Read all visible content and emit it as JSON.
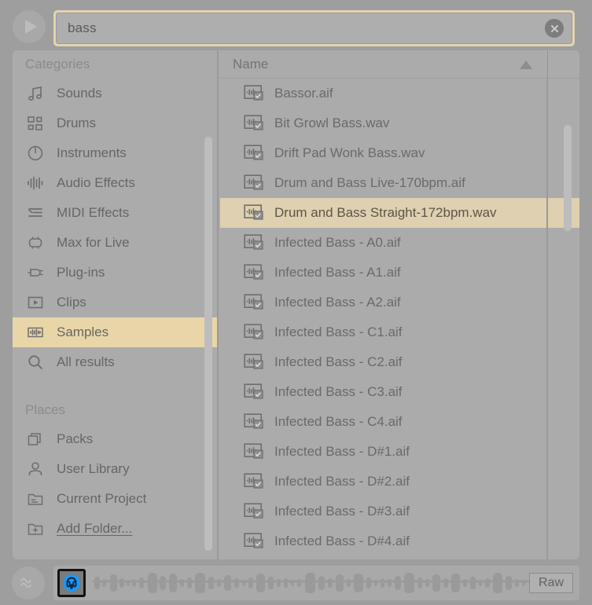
{
  "app": {
    "name": "Ableton Live Browser",
    "accent_highlight": "#e9d6a8",
    "selection_highlight": "#ded0b0",
    "background": "#9e9e9e",
    "panel_background": "#ababab",
    "preview_active_color": "#2196f3"
  },
  "topbar": {
    "play_icon": "play-triangle-icon",
    "search": {
      "value": "bass",
      "placeholder": "Search",
      "clear_icon": "close-circle-icon",
      "clear_glyph": "✕"
    }
  },
  "sidebar": {
    "sections": [
      {
        "title": "Categories",
        "items": [
          {
            "label": "Sounds",
            "icon": "music-note-icon",
            "active": false
          },
          {
            "label": "Drums",
            "icon": "drum-grid-icon",
            "active": false
          },
          {
            "label": "Instruments",
            "icon": "knob-dial-icon",
            "active": false
          },
          {
            "label": "Audio Effects",
            "icon": "waveform-bars-icon",
            "active": false
          },
          {
            "label": "MIDI Effects",
            "icon": "midi-lines-icon",
            "active": false
          },
          {
            "label": "Max for Live",
            "icon": "max-device-icon",
            "active": false
          },
          {
            "label": "Plug-ins",
            "icon": "plug-icon",
            "active": false
          },
          {
            "label": "Clips",
            "icon": "clip-play-icon",
            "active": false
          },
          {
            "label": "Samples",
            "icon": "sample-wave-icon",
            "active": true
          },
          {
            "label": "All results",
            "icon": "search-icon",
            "active": false
          }
        ]
      },
      {
        "title": "Places",
        "items": [
          {
            "label": "Packs",
            "icon": "packs-stack-icon",
            "active": false
          },
          {
            "label": "User Library",
            "icon": "user-person-icon",
            "active": false
          },
          {
            "label": "Current Project",
            "icon": "folder-lines-icon",
            "active": false
          },
          {
            "label": "Add Folder...",
            "icon": "folder-plus-icon",
            "active": false,
            "underlined": true
          }
        ]
      }
    ],
    "scrollbar": "vertical-scrollbar-sidebar"
  },
  "list": {
    "column_header": "Name",
    "sort_direction": "ascending",
    "sort_icon": "sort-ascending-arrow-icon",
    "row_icon": "audio-sample-file-icon",
    "rows": [
      {
        "name": "Bassor.aif",
        "selected": false
      },
      {
        "name": "Bit Growl Bass.wav",
        "selected": false
      },
      {
        "name": "Drift Pad Wonk Bass.wav",
        "selected": false
      },
      {
        "name": "Drum and Bass Live-170bpm.aif",
        "selected": false
      },
      {
        "name": "Drum and Bass Straight-172bpm.wav",
        "selected": true
      },
      {
        "name": "Infected Bass - A0.aif",
        "selected": false
      },
      {
        "name": "Infected Bass - A1.aif",
        "selected": false
      },
      {
        "name": "Infected Bass - A2.aif",
        "selected": false
      },
      {
        "name": "Infected Bass - C1.aif",
        "selected": false
      },
      {
        "name": "Infected Bass - C2.aif",
        "selected": false
      },
      {
        "name": "Infected Bass - C3.aif",
        "selected": false
      },
      {
        "name": "Infected Bass - C4.aif",
        "selected": false
      },
      {
        "name": "Infected Bass - D#1.aif",
        "selected": false
      },
      {
        "name": "Infected Bass - D#2.aif",
        "selected": false
      },
      {
        "name": "Infected Bass - D#3.aif",
        "selected": false
      },
      {
        "name": "Infected Bass - D#4.aif",
        "selected": false
      }
    ],
    "scrollbar": "vertical-scrollbar-list"
  },
  "bottombar": {
    "tilde_icon": "sine-wave-icon",
    "preview_button": {
      "icon": "headphones-icon",
      "active": true
    },
    "waveform": "audio-waveform-preview",
    "raw_button": {
      "label": "Raw"
    }
  }
}
